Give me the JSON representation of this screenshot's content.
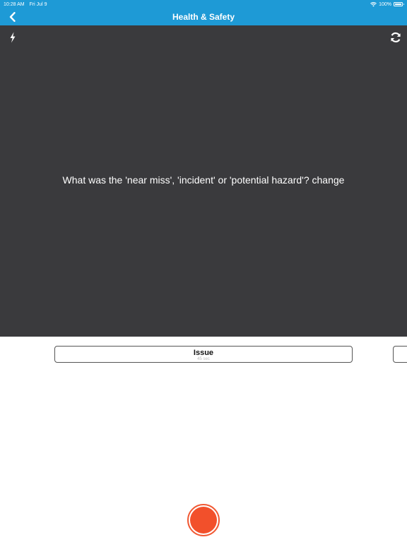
{
  "status_bar": {
    "time": "10:28 AM",
    "date": "Fri Jul 9",
    "battery": "100%",
    "battery_level": 1.0,
    "wifi_icon": "wifi-icon"
  },
  "nav": {
    "title": "Health & Safety",
    "back_icon": "chevron-left-icon"
  },
  "camera": {
    "flash_icon": "flash-icon",
    "rotate_icon": "camera-rotate-icon",
    "prompt": "What was the 'near miss', 'incident' or 'potential hazard'? change"
  },
  "segments": [
    {
      "title": "Issue",
      "duration": "45 sec"
    }
  ],
  "record_button": {
    "icon": "record-icon"
  },
  "colors": {
    "header": "#1e9ad6",
    "camera_background": "#3a3a3d",
    "record": "#f2502b"
  }
}
